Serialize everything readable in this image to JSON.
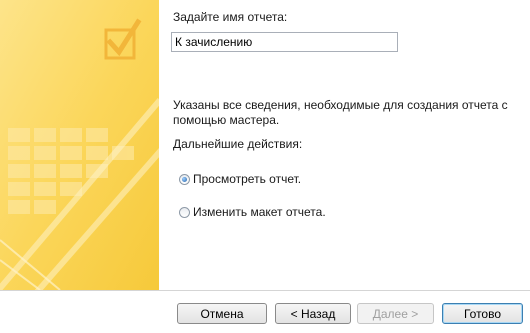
{
  "report_name": {
    "label": "Задайте имя отчета:",
    "value": "К зачислению"
  },
  "info_text": "Указаны все сведения, необходимые для создания отчета с помощью мастера.",
  "next_action_label": "Дальнейшие действия:",
  "options": [
    {
      "label": "Просмотреть отчет.",
      "checked": true
    },
    {
      "label": "Изменить макет отчета.",
      "checked": false
    }
  ],
  "buttons": {
    "cancel": "Отмена",
    "back": "< Назад",
    "next": "Далее >",
    "finish": "Готово"
  },
  "colors": {
    "art_panel": "#fbd65a",
    "primary_border": "#3c7fb1"
  },
  "icons": [
    "checkmark-box-icon"
  ]
}
